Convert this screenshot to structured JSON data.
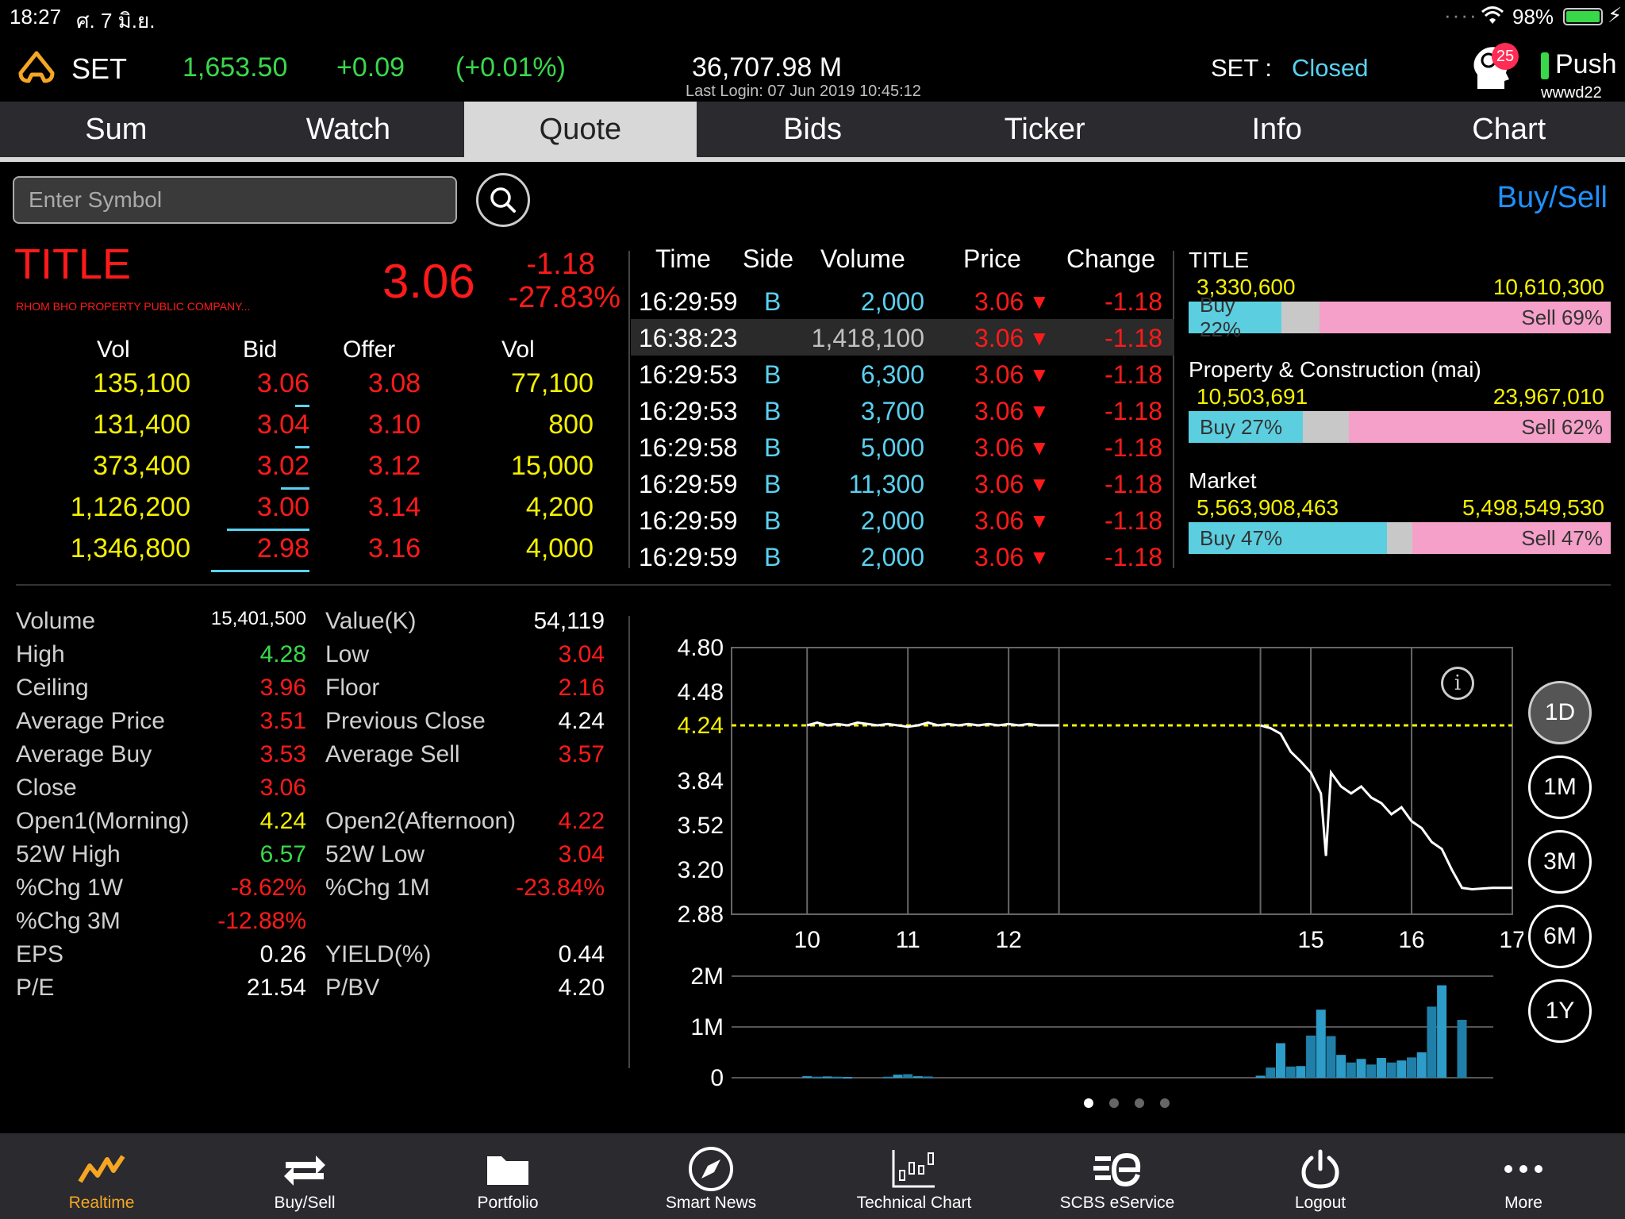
{
  "status": {
    "time": "18:27",
    "date": "ศ. 7 มิ.ย.",
    "battery": "98%"
  },
  "header": {
    "index_name": "SET",
    "index_value": "1,653.50",
    "index_change": "+0.09",
    "index_pct": "(+0.01%)",
    "market_value": "36,707.98 M",
    "last_login": "Last Login: 07 Jun 2019 10:45:12",
    "market_label": "SET :",
    "market_status": "Closed",
    "notif_count": "25",
    "push_label": "Push",
    "user": "wwwd22"
  },
  "tabs": [
    "Sum",
    "Watch",
    "Quote",
    "Bids",
    "Ticker",
    "Info",
    "Chart"
  ],
  "search": {
    "placeholder": "Enter Symbol",
    "buy_sell": "Buy/Sell"
  },
  "quote": {
    "symbol": "TITLE",
    "company": "RHOM BHO PROPERTY PUBLIC COMPANY...",
    "price": "3.06",
    "change": "-1.18",
    "pct": "-27.83%"
  },
  "orderbook": {
    "headers": [
      "Vol",
      "Bid",
      "Offer",
      "Vol"
    ],
    "rows": [
      {
        "bid_vol": "135,100",
        "bid": "3.06",
        "offer": "3.08",
        "offer_vol": "77,100"
      },
      {
        "bid_vol": "131,400",
        "bid": "3.04",
        "offer": "3.10",
        "offer_vol": "800"
      },
      {
        "bid_vol": "373,400",
        "bid": "3.02",
        "offer": "3.12",
        "offer_vol": "15,000"
      },
      {
        "bid_vol": "1,126,200",
        "bid": "3.00",
        "offer": "3.14",
        "offer_vol": "4,200"
      },
      {
        "bid_vol": "1,346,800",
        "bid": "2.98",
        "offer": "3.16",
        "offer_vol": "4,000"
      }
    ]
  },
  "trades": {
    "headers": [
      "Time",
      "Side",
      "Volume",
      "Price",
      "Change"
    ],
    "rows": [
      {
        "time": "16:29:59",
        "side": "B",
        "volume": "2,000",
        "price": "3.06",
        "change": "-1.18"
      },
      {
        "time": "16:38:23",
        "side": "",
        "volume": "1,418,100",
        "price": "3.06",
        "change": "-1.18"
      },
      {
        "time": "16:29:53",
        "side": "B",
        "volume": "6,300",
        "price": "3.06",
        "change": "-1.18"
      },
      {
        "time": "16:29:53",
        "side": "B",
        "volume": "3,700",
        "price": "3.06",
        "change": "-1.18"
      },
      {
        "time": "16:29:58",
        "side": "B",
        "volume": "5,000",
        "price": "3.06",
        "change": "-1.18"
      },
      {
        "time": "16:29:59",
        "side": "B",
        "volume": "11,300",
        "price": "3.06",
        "change": "-1.18"
      },
      {
        "time": "16:29:59",
        "side": "B",
        "volume": "2,000",
        "price": "3.06",
        "change": "-1.18"
      },
      {
        "time": "16:29:59",
        "side": "B",
        "volume": "2,000",
        "price": "3.06",
        "change": "-1.18"
      }
    ]
  },
  "sentiment": [
    {
      "label": "TITLE",
      "buy_value": "3,330,600",
      "sell_value": "10,610,300",
      "buy_label": "Buy 22%",
      "sell_label": "Sell 69%",
      "buy_pct": 22,
      "sell_pct": 69
    },
    {
      "label": "Property & Construction (mai)",
      "buy_value": "10,503,691",
      "sell_value": "23,967,010",
      "buy_label": "Buy 27%",
      "sell_label": "Sell 62%",
      "buy_pct": 27,
      "sell_pct": 62
    },
    {
      "label": "Market",
      "buy_value": "5,563,908,463",
      "sell_value": "5,498,549,530",
      "buy_label": "Buy 47%",
      "sell_label": "Sell 47%",
      "buy_pct": 47,
      "sell_pct": 47
    }
  ],
  "stats": {
    "left": [
      {
        "label": "Volume",
        "value": "15,401,500",
        "color": "#ffffff"
      },
      {
        "label": "High",
        "value": "4.28",
        "color": "#39d84b"
      },
      {
        "label": "Ceiling",
        "value": "3.96",
        "color": "#ff1a1a"
      },
      {
        "label": "Average Price",
        "value": "3.51",
        "color": "#ff1a1a"
      },
      {
        "label": "Average Buy",
        "value": "3.53",
        "color": "#ff1a1a"
      },
      {
        "label": "Close",
        "value": "3.06",
        "color": "#ff1a1a"
      },
      {
        "label": "Open1(Morning)",
        "value": "4.24",
        "color": "#f4f000"
      },
      {
        "label": "52W High",
        "value": "6.57",
        "color": "#39d84b"
      },
      {
        "label": "%Chg 1W",
        "value": "-8.62%",
        "color": "#ff1a1a"
      },
      {
        "label": "%Chg 3M",
        "value": "-12.88%",
        "color": "#ff1a1a"
      },
      {
        "label": "EPS",
        "value": "0.26",
        "color": "#ffffff"
      },
      {
        "label": "P/E",
        "value": "21.54",
        "color": "#ffffff"
      }
    ],
    "right": [
      {
        "label": "Value(K)",
        "value": "54,119",
        "color": "#ffffff"
      },
      {
        "label": "Low",
        "value": "3.04",
        "color": "#ff1a1a"
      },
      {
        "label": "Floor",
        "value": "2.16",
        "color": "#ff1a1a"
      },
      {
        "label": "Previous Close",
        "value": "4.24",
        "color": "#ffffff"
      },
      {
        "label": "Average Sell",
        "value": "3.57",
        "color": "#ff1a1a"
      },
      {
        "label": "",
        "value": "",
        "color": "#ffffff"
      },
      {
        "label": "Open2(Afternoon)",
        "value": "4.22",
        "color": "#ff1a1a"
      },
      {
        "label": "52W Low",
        "value": "3.04",
        "color": "#ff1a1a"
      },
      {
        "label": "%Chg 1M",
        "value": "-23.84%",
        "color": "#ff1a1a"
      },
      {
        "label": "",
        "value": "",
        "color": "#ffffff"
      },
      {
        "label": "YIELD(%)",
        "value": "0.44",
        "color": "#ffffff"
      },
      {
        "label": "P/BV",
        "value": "4.20",
        "color": "#ffffff"
      }
    ]
  },
  "chart_data": {
    "type": "line",
    "y_ticks": [
      "4.80",
      "4.48",
      "4.24",
      "3.84",
      "3.52",
      "3.20",
      "2.88"
    ],
    "x_ticks": [
      "10",
      "11",
      "12",
      "15",
      "16",
      "17"
    ],
    "ylim": [
      2.88,
      4.8
    ],
    "prev_close": 4.24,
    "morning": {
      "x": [
        10.0,
        10.1,
        10.2,
        10.3,
        10.4,
        10.5,
        10.6,
        10.7,
        10.8,
        10.9,
        11.0,
        11.1,
        11.2,
        11.3,
        11.4,
        11.5,
        11.6,
        11.7,
        11.8,
        11.9,
        12.0,
        12.1,
        12.2,
        12.3,
        12.5
      ],
      "y": [
        4.24,
        4.26,
        4.24,
        4.25,
        4.24,
        4.26,
        4.25,
        4.24,
        4.25,
        4.24,
        4.23,
        4.24,
        4.26,
        4.24,
        4.25,
        4.24,
        4.25,
        4.24,
        4.25,
        4.24,
        4.25,
        4.24,
        4.25,
        4.24,
        4.24
      ]
    },
    "afternoon": {
      "x": [
        14.5,
        14.6,
        14.7,
        14.8,
        14.9,
        15.0,
        15.1,
        15.15,
        15.2,
        15.3,
        15.4,
        15.5,
        15.6,
        15.7,
        15.8,
        15.9,
        16.0,
        16.1,
        16.2,
        16.3,
        16.4,
        16.5,
        16.6,
        16.8,
        17.0
      ],
      "y": [
        4.24,
        4.22,
        4.18,
        4.05,
        3.98,
        3.9,
        3.75,
        3.3,
        3.9,
        3.8,
        3.75,
        3.8,
        3.72,
        3.68,
        3.6,
        3.65,
        3.55,
        3.5,
        3.4,
        3.35,
        3.2,
        3.07,
        3.06,
        3.07,
        3.07
      ]
    },
    "volume": {
      "y_ticks": [
        "2M",
        "1M",
        "0"
      ],
      "ylim": [
        0,
        2000000
      ],
      "bars": [
        {
          "x": 10.0,
          "v": 30000
        },
        {
          "x": 10.1,
          "v": 20000
        },
        {
          "x": 10.2,
          "v": 25000
        },
        {
          "x": 10.3,
          "v": 20000
        },
        {
          "x": 10.4,
          "v": 15000
        },
        {
          "x": 10.8,
          "v": 20000
        },
        {
          "x": 10.9,
          "v": 60000
        },
        {
          "x": 11.0,
          "v": 70000
        },
        {
          "x": 11.1,
          "v": 30000
        },
        {
          "x": 11.2,
          "v": 25000
        },
        {
          "x": 14.5,
          "v": 40000
        },
        {
          "x": 14.6,
          "v": 200000
        },
        {
          "x": 14.7,
          "v": 680000
        },
        {
          "x": 14.8,
          "v": 220000
        },
        {
          "x": 14.9,
          "v": 230000
        },
        {
          "x": 15.0,
          "v": 830000
        },
        {
          "x": 15.1,
          "v": 1340000
        },
        {
          "x": 15.2,
          "v": 820000
        },
        {
          "x": 15.3,
          "v": 450000
        },
        {
          "x": 15.4,
          "v": 300000
        },
        {
          "x": 15.5,
          "v": 370000
        },
        {
          "x": 15.6,
          "v": 260000
        },
        {
          "x": 15.7,
          "v": 390000
        },
        {
          "x": 15.8,
          "v": 300000
        },
        {
          "x": 15.9,
          "v": 340000
        },
        {
          "x": 16.0,
          "v": 400000
        },
        {
          "x": 16.1,
          "v": 500000
        },
        {
          "x": 16.2,
          "v": 1400000
        },
        {
          "x": 16.3,
          "v": 1820000
        },
        {
          "x": 16.5,
          "v": 1140000
        }
      ]
    }
  },
  "periods": [
    "1D",
    "1M",
    "3M",
    "6M",
    "1Y"
  ],
  "bottom_nav": [
    "Realtime",
    "Buy/Sell",
    "Portfolio",
    "Smart News",
    "Technical Chart",
    "SCBS eService",
    "Logout",
    "More"
  ],
  "colors": {
    "up": "#39d84b",
    "down": "#ff1a1a",
    "unchanged": "#f4f000",
    "accent": "#f5a623",
    "link": "#1e90ff"
  }
}
